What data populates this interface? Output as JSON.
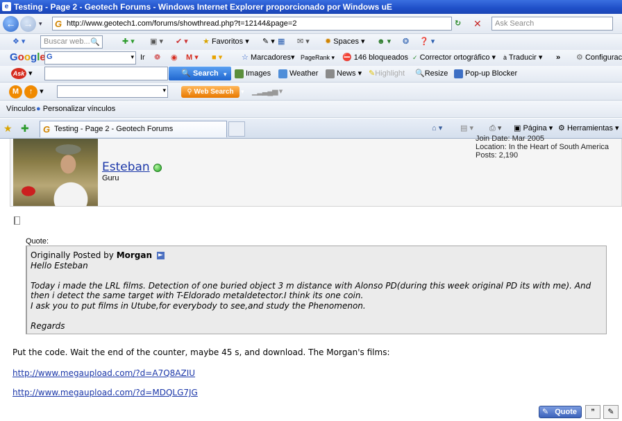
{
  "window": {
    "title": "Testing - Page 2 - Geotech Forums - Windows Internet Explorer proporcionado por Windows uE"
  },
  "address": {
    "url": "http://www.geotech1.com/forums/showthread.php?t=12144&page=2",
    "search_placeholder": "Ask Search"
  },
  "toolbar1": {
    "search_placeholder": "Buscar web...",
    "favoritos": "Favoritos",
    "spaces": "Spaces"
  },
  "google_bar": {
    "ir": "Ir",
    "marcadores": "Marcadores",
    "pagerank": "PageRank",
    "bloqueados": "146 bloqueados",
    "corrector": "Corrector ortográfico",
    "traducir": "Traducir",
    "configuracion": "Configurac"
  },
  "ask_bar": {
    "search_label": "Search",
    "images": "Images",
    "weather": "Weather",
    "news": "News",
    "highlight": "Highlight",
    "resize": "Resize",
    "popup": "Pop-up Blocker"
  },
  "mail_bar": {
    "web_search": "Web Search"
  },
  "links_bar": {
    "vinculos": "Vínculos",
    "personalizar": "Personalizar vínculos"
  },
  "tabs": {
    "active": "Testing - Page 2 - Geotech Forums",
    "pagina": "Página",
    "herramientas": "Herramientas"
  },
  "post": {
    "username": "Esteban",
    "usertitle": "Guru",
    "join_date": "Join Date: Mar 2005",
    "location": "Location: In the Heart of South America",
    "posts": "Posts: 2,190",
    "quote_label": "Quote:",
    "quote_origin_prefix": "Originally Posted by",
    "quote_author": "Morgan",
    "quote_lines": [
      "Hello Esteban",
      "",
      "Today i made the LRL films. Detection of one buried object 3 m distance with Alonso PD(during this week original PD its with me). And",
      "then i detect the same target with T-Eldorado metaldetector.I think its one coin.",
      "I ask you to put films in Utube,for everybody to see,and study the Phenomenon.",
      "",
      "Regards"
    ],
    "body_text": "Put the code. Wait the end of the counter, maybe 45 s, and download. The Morgan's films:",
    "link1": "http://www.megaupload.com/?d=A7Q8AZIU",
    "link2": "http://www.megaupload.com/?d=MDQLG7JG",
    "quote_button": "Quote"
  },
  "colors": {
    "title_bar": "#1f4fc8",
    "link": "#1a36a8",
    "quote_bg": "#ebebeb",
    "online": "#22a522"
  }
}
